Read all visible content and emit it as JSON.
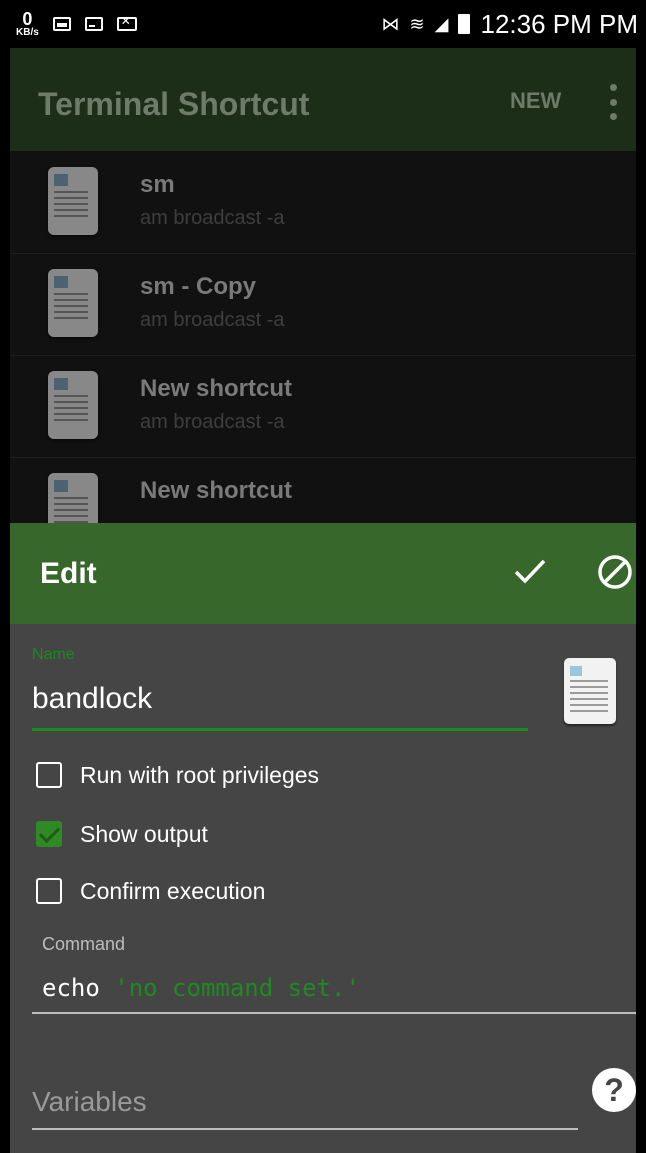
{
  "status_bar": {
    "kbs_value": "0",
    "kbs_unit": "KB/s",
    "time": "12:36 PM PM"
  },
  "app_bar": {
    "title": "Terminal Shortcut",
    "new_label": "NEW"
  },
  "shortcuts": [
    {
      "title": "sm",
      "subtitle": "am broadcast -a"
    },
    {
      "title": "sm - Copy",
      "subtitle": "am broadcast -a"
    },
    {
      "title": "New shortcut",
      "subtitle": "am broadcast -a"
    },
    {
      "title": "New shortcut",
      "subtitle": ""
    }
  ],
  "dialog": {
    "title": "Edit",
    "name_label": "Name",
    "name_value": "bandlock",
    "options": {
      "root": {
        "label": "Run with root privileges",
        "checked": false
      },
      "output": {
        "label": "Show output",
        "checked": true
      },
      "confirm": {
        "label": "Confirm execution",
        "checked": false
      }
    },
    "command_label": "Command",
    "command_keyword": "echo",
    "command_string": "'no command set.'",
    "variables_placeholder": "Variables",
    "help_label": "?"
  },
  "colors": {
    "header_green": "#37672a",
    "accent_green": "#1c8a1c",
    "dialog_bg": "#454545"
  }
}
